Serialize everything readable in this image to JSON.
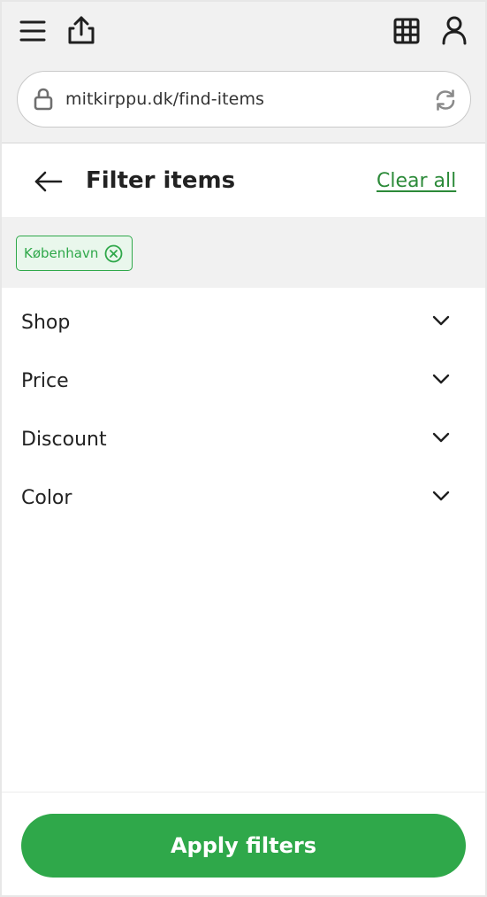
{
  "browser": {
    "url": "mitkirppu.dk/find-items",
    "icons": [
      "menu-icon",
      "share-icon",
      "grid-icon",
      "user-icon",
      "lock-icon",
      "reload-icon"
    ]
  },
  "header": {
    "title": "Filter items",
    "clear_all_label": "Clear all",
    "back_icon": "back-arrow-icon"
  },
  "active_chips": [
    {
      "label": "København",
      "remove_icon": "close-circle-icon"
    }
  ],
  "filters": [
    {
      "label": "Shop",
      "icon": "chevron-down-icon"
    },
    {
      "label": "Price",
      "icon": "chevron-down-icon"
    },
    {
      "label": "Discount",
      "icon": "chevron-down-icon"
    },
    {
      "label": "Color",
      "icon": "chevron-down-icon"
    }
  ],
  "footer": {
    "apply_label": "Apply filters"
  },
  "colors": {
    "accent": "#2fa84a",
    "link": "#2c8a39",
    "chrome_bg": "#f1f1f1",
    "text": "#222222"
  }
}
